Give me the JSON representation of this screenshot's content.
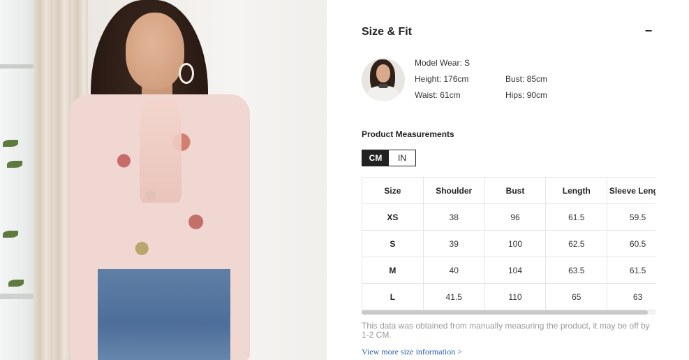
{
  "size_fit": {
    "title": "Size & Fit",
    "collapse_symbol": "−"
  },
  "model": {
    "wear": "Model Wear: S",
    "height": "Height: 176cm",
    "bust": "Bust: 85cm",
    "waist": "Waist: 61cm",
    "hips": "Hips: 90cm"
  },
  "measurements": {
    "title": "Product Measurements",
    "units": {
      "cm": "CM",
      "in": "IN",
      "selected": "CM"
    },
    "headers": [
      "Size",
      "Shoulder",
      "Bust",
      "Length",
      "Sleeve Length"
    ],
    "rows": [
      [
        "XS",
        "38",
        "96",
        "61.5",
        "59.5"
      ],
      [
        "S",
        "39",
        "100",
        "62.5",
        "60.5"
      ],
      [
        "M",
        "40",
        "104",
        "63.5",
        "61.5"
      ],
      [
        "L",
        "41.5",
        "110",
        "65",
        "63"
      ]
    ]
  },
  "note": "This data was obtained from manually measuring the product, it may be off by 1-2 CM.",
  "view_more": "View more size information >"
}
